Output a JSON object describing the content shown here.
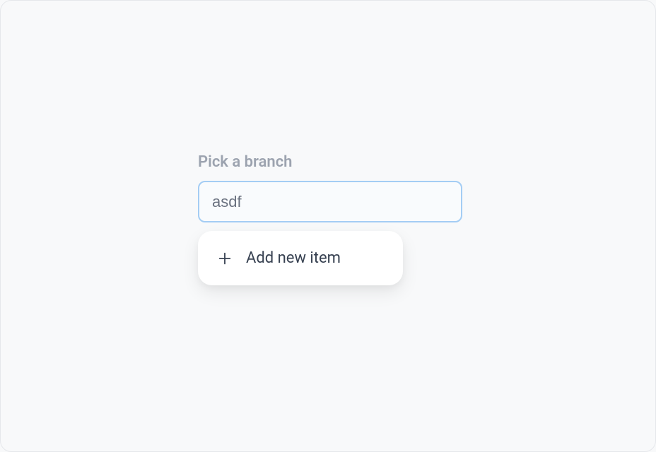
{
  "branchPicker": {
    "label": "Pick a branch",
    "inputValue": "asdf"
  },
  "dropdown": {
    "addItemLabel": "Add new item"
  }
}
